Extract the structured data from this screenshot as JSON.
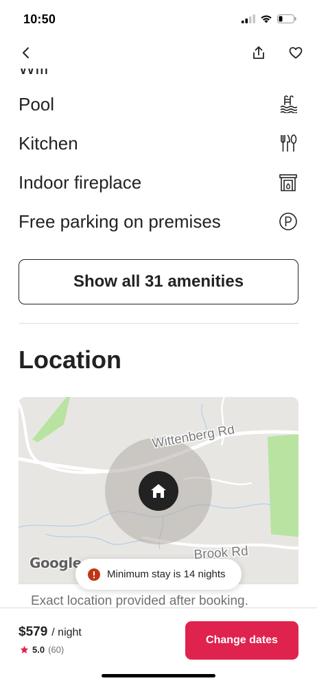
{
  "status_bar": {
    "time": "10:50"
  },
  "amenities": {
    "cut_item": "Wifi",
    "items": [
      {
        "label": "Pool",
        "icon": "pool-icon"
      },
      {
        "label": "Kitchen",
        "icon": "kitchen-icon"
      },
      {
        "label": "Indoor fireplace",
        "icon": "fireplace-icon"
      },
      {
        "label": "Free parking on premises",
        "icon": "parking-icon"
      }
    ],
    "show_all_label": "Show all 31 amenities"
  },
  "location": {
    "title": "Location",
    "map": {
      "road_1": "Wittenberg Rd",
      "road_2": "Brook Rd",
      "attribution": "Google",
      "caption": "Exact location provided after booking."
    },
    "toast": "Minimum stay is 14 nights"
  },
  "footer": {
    "price": "$579",
    "per_night": "/ night",
    "rating": "5.0",
    "reviews": "(60)",
    "cta_label": "Change dates"
  },
  "colors": {
    "accent": "#E0224F",
    "text": "#222222",
    "muted": "#717171",
    "map_park": "#b8e3a1",
    "map_base": "#e8e6e3",
    "toast_error": "#c13515",
    "star": "#E0224F"
  }
}
